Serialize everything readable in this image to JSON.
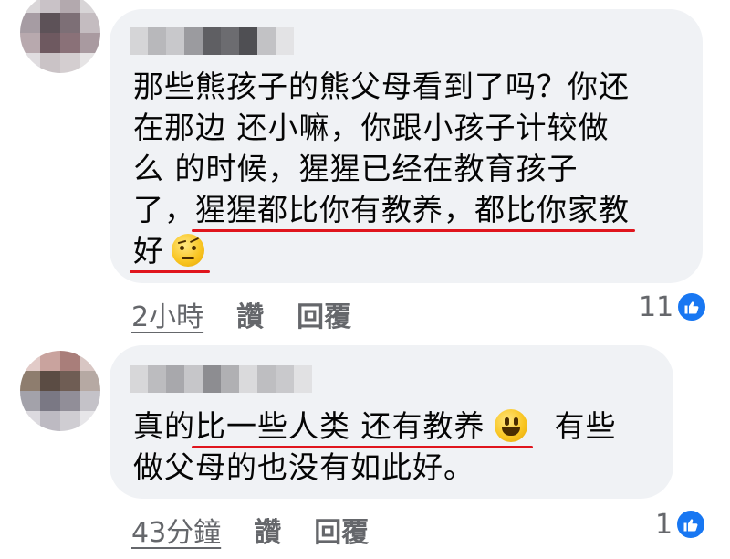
{
  "comments": [
    {
      "text_lines": [
        {
          "pre": "那些熊孩子的熊父母看到了吗？你还",
          "u": "",
          "post": ""
        },
        {
          "pre": "在那边 还小嘛，你跟小孩子计较做",
          "u": "",
          "post": ""
        },
        {
          "pre": "么 的时候，猩猩已经在教育孩子",
          "u": "",
          "post": ""
        },
        {
          "pre": "了，",
          "u": "猩猩都比你有教养，都比你家教",
          "post": ""
        },
        {
          "pre": "",
          "u": "好",
          "post": ""
        }
      ],
      "emoji": "face-with-raised-eyebrow",
      "time": "2小時",
      "like_label": "讚",
      "reply_label": "回覆",
      "reaction_count": "11"
    },
    {
      "text_lines": [
        {
          "pre": "真的",
          "u": "比一些人类 还有教养",
          "post": ""
        },
        {
          "pre": "做父母的也没有如此好。",
          "u": "",
          "post": ""
        }
      ],
      "emoji": "smiling-face",
      "line1_after_emoji": "有些",
      "time": "43分鐘",
      "like_label": "讚",
      "reply_label": "回覆",
      "reaction_count": "1"
    }
  ],
  "colors": {
    "bubble": "#f0f2f5",
    "underline": "#e0151d",
    "meta_text": "#65676b",
    "like_blue": "#1877f2"
  },
  "icons": {
    "reaction": "thumbs-up-icon"
  }
}
